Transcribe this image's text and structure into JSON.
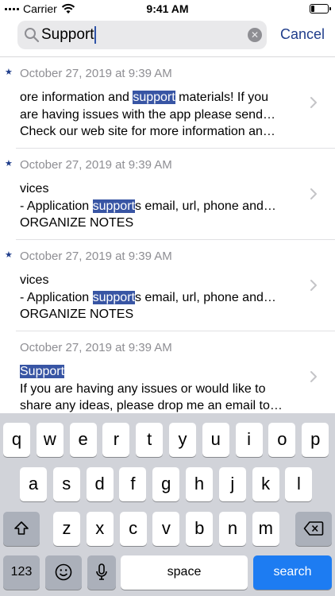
{
  "status_bar": {
    "carrier": "Carrier",
    "time": "9:41 AM"
  },
  "search": {
    "query": "Support",
    "cancel_label": "Cancel"
  },
  "notes": [
    {
      "starred": true,
      "date": "October 27, 2019 at 9:39 AM",
      "lines": [
        [
          {
            "t": "ore information and "
          },
          {
            "t": "support",
            "h": true
          },
          {
            "t": " materials! If you"
          }
        ],
        [
          {
            "t": "are having issues with the app please send…"
          }
        ],
        [
          {
            "t": "Check our web site for more information an…"
          }
        ]
      ]
    },
    {
      "starred": true,
      "date": "October 27, 2019 at 9:39 AM",
      "lines": [
        [
          {
            "t": "vices"
          }
        ],
        [
          {
            "t": "- Application "
          },
          {
            "t": "support",
            "h": true
          },
          {
            "t": "s email, url, phone and…"
          }
        ],
        [
          {
            "t": "ORGANIZE NOTES"
          }
        ]
      ]
    },
    {
      "starred": true,
      "date": "October 27, 2019 at 9:39 AM",
      "lines": [
        [
          {
            "t": "vices"
          }
        ],
        [
          {
            "t": "- Application "
          },
          {
            "t": "support",
            "h": true
          },
          {
            "t": "s email, url, phone and…"
          }
        ],
        [
          {
            "t": "ORGANIZE NOTES"
          }
        ]
      ]
    },
    {
      "starred": false,
      "date": "October 27, 2019 at 9:39 AM",
      "lines": [
        [
          {
            "t": "Support",
            "h": true
          }
        ],
        [
          {
            "t": "If you are having any issues or would like to"
          }
        ],
        [
          {
            "t": "share any ideas, please drop me an email to…"
          }
        ]
      ]
    }
  ],
  "keyboard": {
    "row1": [
      "q",
      "w",
      "e",
      "r",
      "t",
      "y",
      "u",
      "i",
      "o",
      "p"
    ],
    "row2": [
      "a",
      "s",
      "d",
      "f",
      "g",
      "h",
      "j",
      "k",
      "l"
    ],
    "row3": [
      "z",
      "x",
      "c",
      "v",
      "b",
      "n",
      "m"
    ],
    "numbers_label": "123",
    "space_label": "space",
    "search_label": "search"
  },
  "colors": {
    "accent": "#1f3d8b",
    "highlight": "#3855a4",
    "search_key": "#1d7cf2"
  },
  "icons": [
    "signal-icon",
    "wifi-icon",
    "battery-icon",
    "search-icon",
    "clear-icon",
    "star-icon",
    "chevron-right-icon",
    "shift-icon",
    "delete-icon",
    "emoji-icon",
    "microphone-icon"
  ]
}
